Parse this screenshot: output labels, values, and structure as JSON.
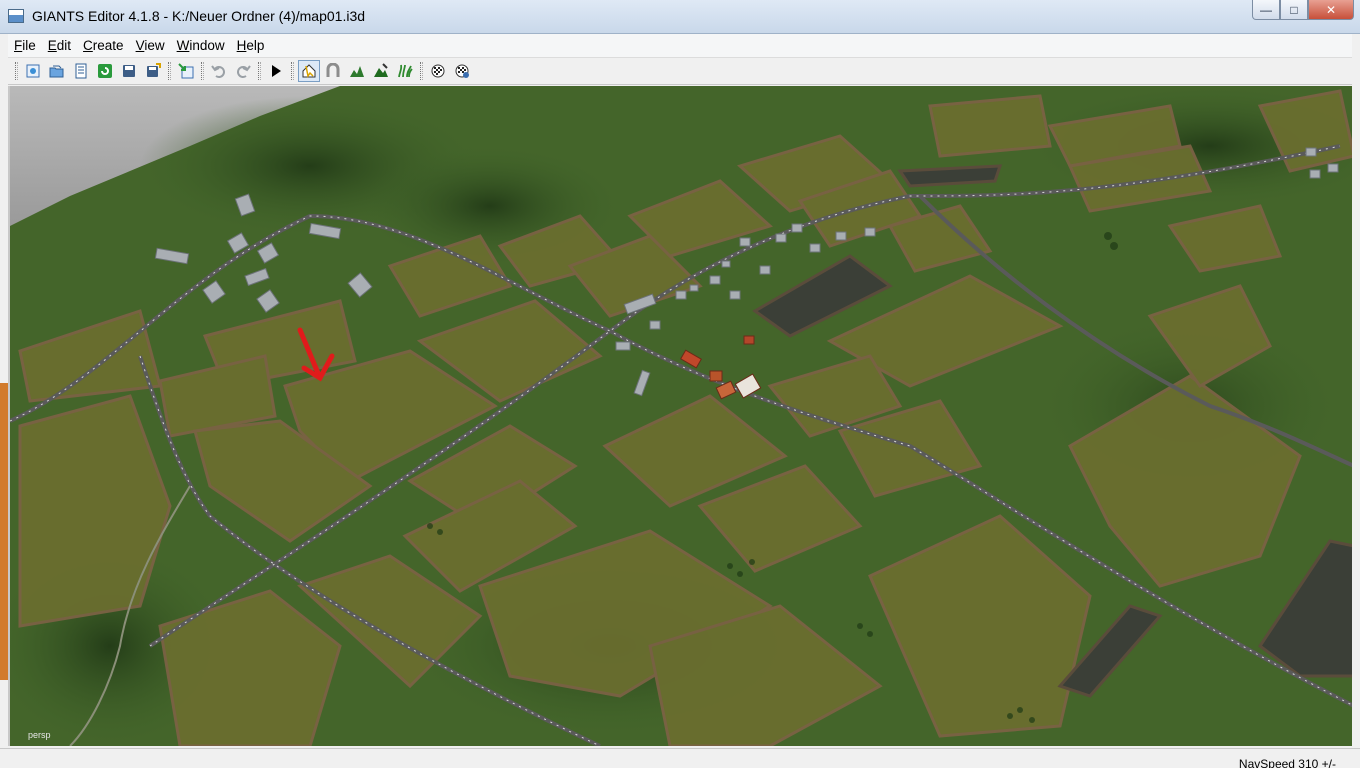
{
  "window": {
    "title": "GIANTS Editor 4.1.8 - K:/Neuer Ordner (4)/map01.i3d",
    "minimize_label": "—",
    "maximize_label": "□",
    "close_label": "✕"
  },
  "menu": {
    "items": [
      {
        "key": "F",
        "rest": "ile"
      },
      {
        "key": "E",
        "rest": "dit"
      },
      {
        "key": "C",
        "rest": "reate"
      },
      {
        "key": "V",
        "rest": "iew"
      },
      {
        "key": "W",
        "rest": "indow"
      },
      {
        "key": "H",
        "rest": "elp"
      }
    ]
  },
  "toolbar": {
    "icons": [
      "new-scene-icon",
      "open-icon",
      "open-list-icon",
      "refresh-icon",
      "save-icon",
      "save-as-icon",
      "import-icon",
      "undo-icon",
      "redo-icon",
      "play-icon",
      "select-tool-icon",
      "move-tool-icon",
      "terrain-sculpt-icon",
      "terrain-paint-icon",
      "foliage-paint-icon",
      "particle-icon",
      "settings-icon"
    ]
  },
  "viewport": {
    "camera_label": "persp",
    "annotation_arrow_color": "#e01b1b"
  },
  "status": {
    "nav_speed": "NavSpeed 310 +/-"
  }
}
